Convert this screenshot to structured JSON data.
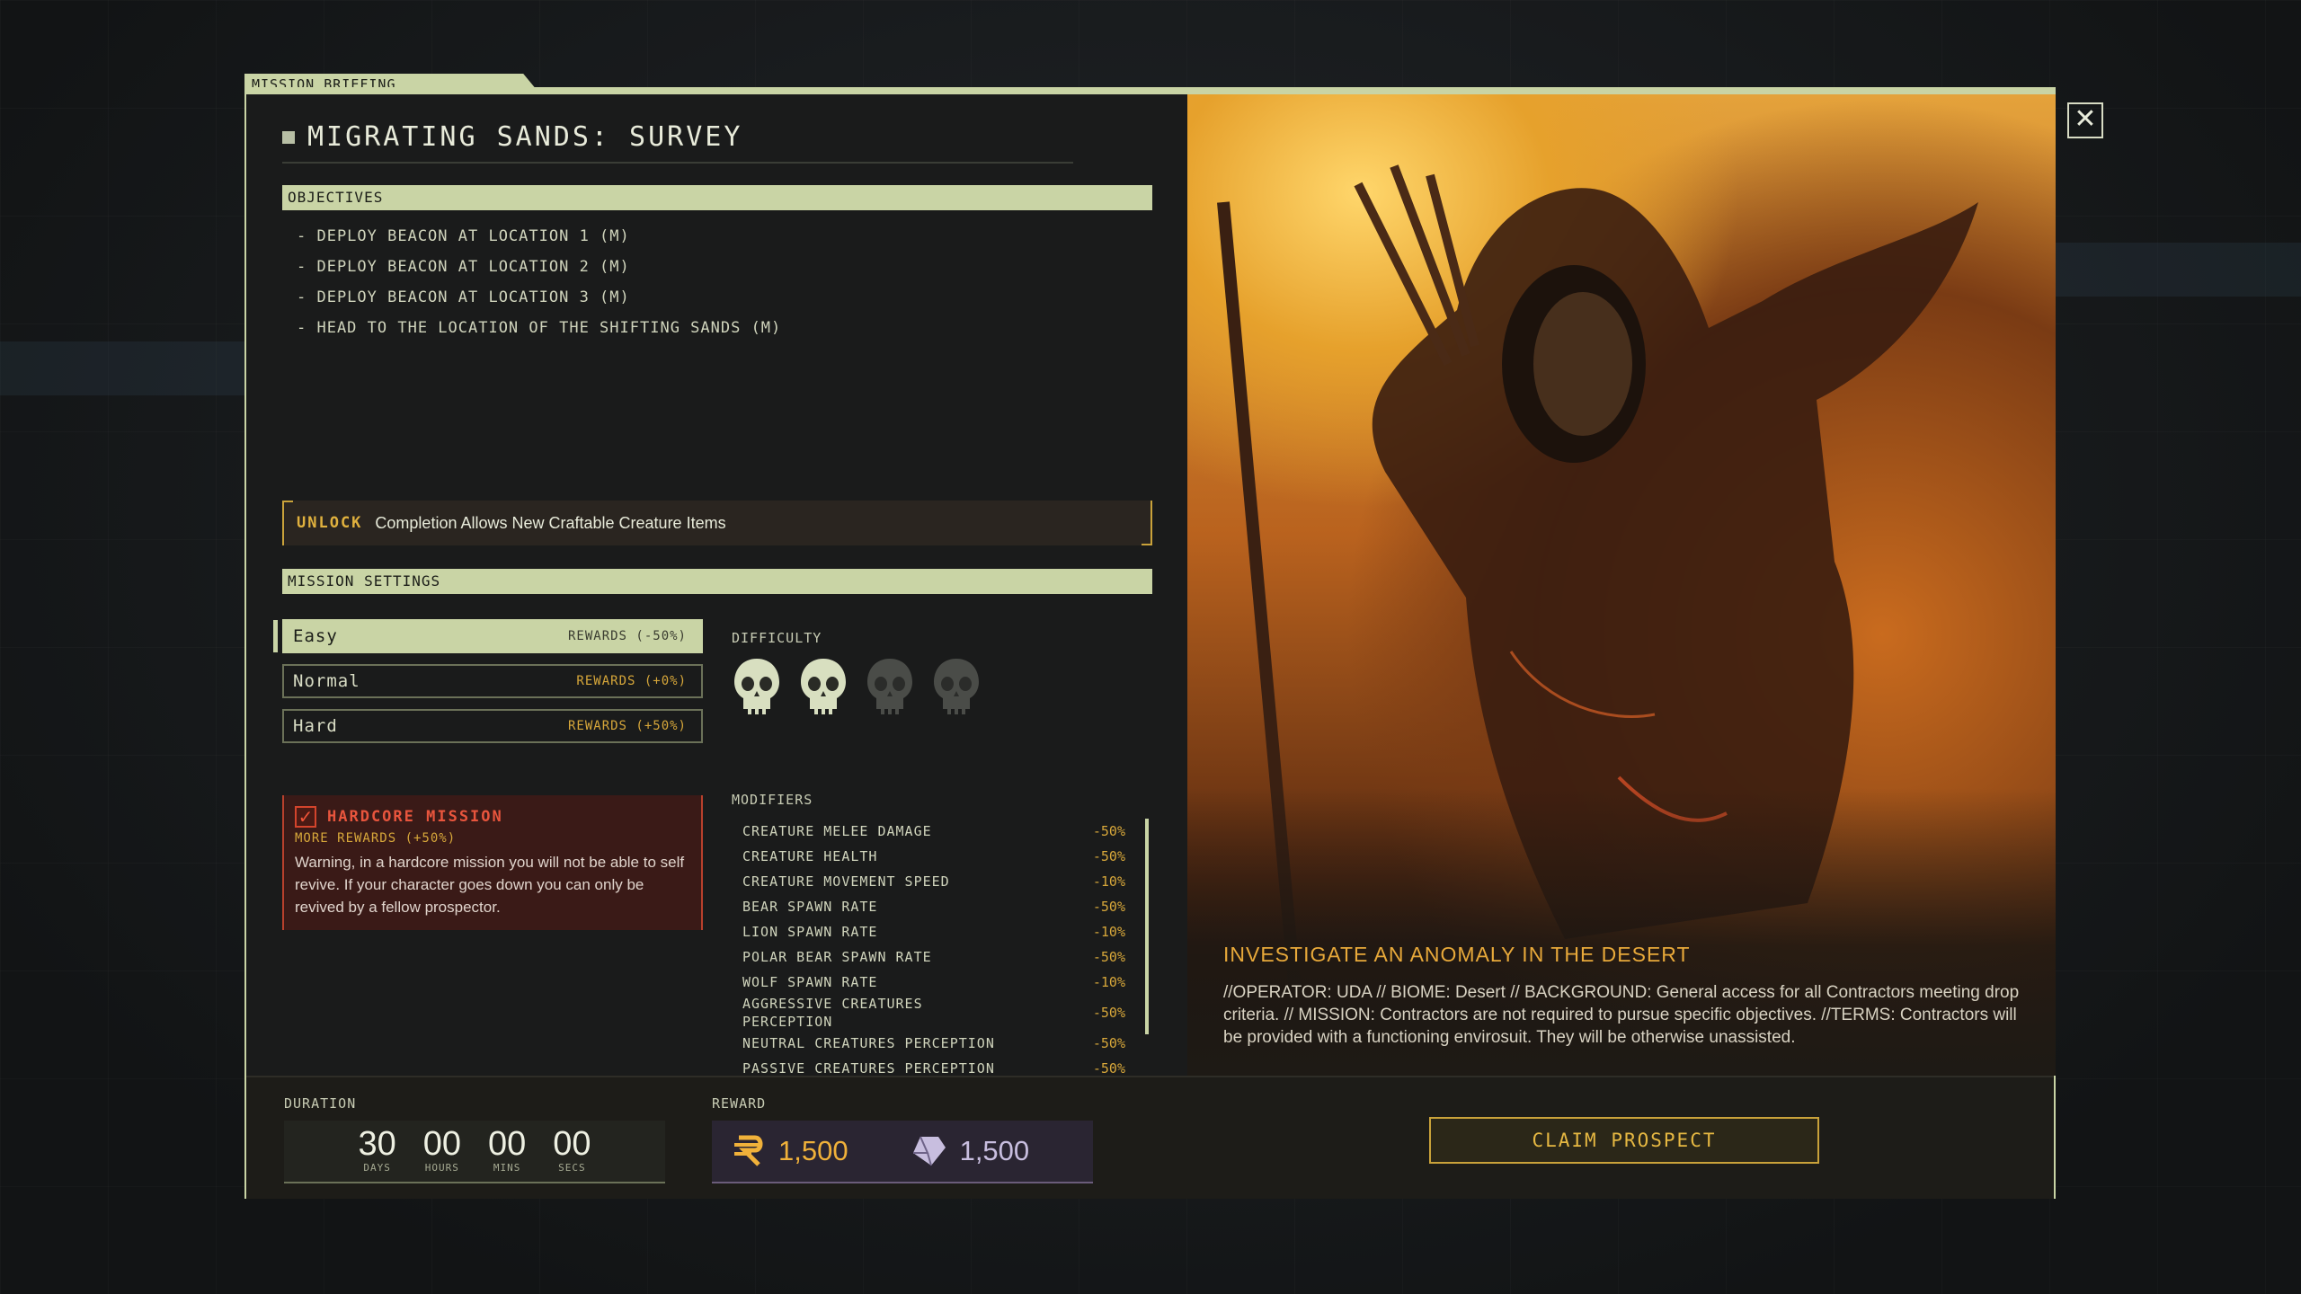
{
  "tab_label": "MISSION BRIEFING",
  "title": "MIGRATING SANDS: SURVEY",
  "objectives": {
    "header": "OBJECTIVES",
    "items": [
      "- DEPLOY BEACON AT LOCATION 1 (M)",
      "- DEPLOY BEACON AT LOCATION 2 (M)",
      "- DEPLOY BEACON AT LOCATION 3 (M)",
      "- HEAD TO THE LOCATION OF THE SHIFTING SANDS (M)"
    ]
  },
  "unlock": {
    "tag": "UNLOCK",
    "text": "Completion Allows New Craftable Creature Items"
  },
  "settings": {
    "header": "MISSION SETTINGS",
    "options": [
      {
        "name": "Easy",
        "rewards": "REWARDS (-50%)",
        "selected": true
      },
      {
        "name": "Normal",
        "rewards": "REWARDS (+0%)",
        "selected": false
      },
      {
        "name": "Hard",
        "rewards": "REWARDS (+50%)",
        "selected": false
      }
    ]
  },
  "hardcore": {
    "title": "HARDCORE MISSION",
    "more": "MORE REWARDS (+50%)",
    "warning": "Warning, in a hardcore mission you will not be able to self revive. If your character goes down you can only be revived by a fellow prospector.",
    "checked": true
  },
  "difficulty": {
    "label": "DIFFICULTY",
    "level": 2,
    "max": 4
  },
  "modifiers": {
    "label": "MODIFIERS",
    "items": [
      {
        "name": "CREATURE MELEE DAMAGE",
        "value": "-50%"
      },
      {
        "name": "CREATURE HEALTH",
        "value": "-50%"
      },
      {
        "name": "CREATURE MOVEMENT SPEED",
        "value": "-10%"
      },
      {
        "name": "BEAR SPAWN RATE",
        "value": "-50%"
      },
      {
        "name": "LION SPAWN RATE",
        "value": "-10%"
      },
      {
        "name": "POLAR BEAR SPAWN RATE",
        "value": "-50%"
      },
      {
        "name": "WOLF SPAWN RATE",
        "value": "-10%"
      },
      {
        "name": "AGGRESSIVE CREATURES PERCEPTION",
        "value": "-50%"
      },
      {
        "name": "NEUTRAL CREATURES PERCEPTION",
        "value": "-50%"
      },
      {
        "name": "PASSIVE CREATURES PERCEPTION",
        "value": "-50%"
      }
    ]
  },
  "art": {
    "heading": "INVESTIGATE AN ANOMALY  IN THE DESERT",
    "description": "//OPERATOR: UDA // BIOME: Desert // BACKGROUND: General access for all Contractors meeting drop criteria. // MISSION: Contractors are not required to pursue specific objectives. //TERMS: Contractors will be provided with a functioning envirosuit. They will be otherwise unassisted."
  },
  "footer": {
    "duration_label": "DURATION",
    "duration": [
      {
        "num": "30",
        "cap": "DAYS"
      },
      {
        "num": "00",
        "cap": "HOURS"
      },
      {
        "num": "00",
        "cap": "MINS"
      },
      {
        "num": "00",
        "cap": "SECS"
      }
    ],
    "reward_label": "REWARD",
    "rewards": [
      {
        "icon": "rebel-credit-icon",
        "value": "1,500",
        "color": "#f0b13a"
      },
      {
        "icon": "exotic-crystal-icon",
        "value": "1,500",
        "color": "#c8bedf"
      }
    ],
    "claim_label": "CLAIM PROSPECT"
  },
  "colors": {
    "accent": "#c9d4a5",
    "gold": "#d7a73a",
    "danger": "#e8553d"
  }
}
